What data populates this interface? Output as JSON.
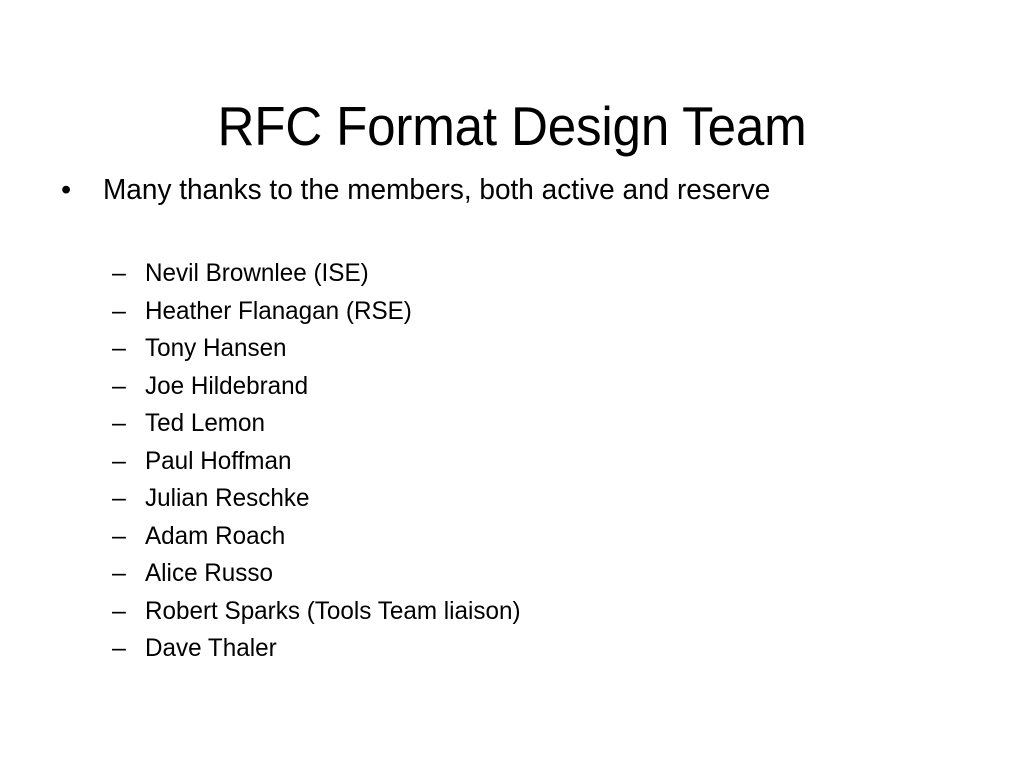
{
  "slide": {
    "background_color": "#FFFFFF",
    "text_color": "#000000",
    "title": "RFC Format Design Team",
    "body": {
      "bullet": {
        "marker": "•",
        "text": "Many thanks to the members, both active and reserve"
      },
      "sub_marker": "–",
      "members": [
        {
          "name": "Nevil Brownlee (ISE)"
        },
        {
          "name": "Heather Flanagan (RSE)"
        },
        {
          "name": "Tony Hansen"
        },
        {
          "name": "Joe Hildebrand"
        },
        {
          "name": "Ted Lemon"
        },
        {
          "name": "Paul Hoffman"
        },
        {
          "name": "Julian Reschke"
        },
        {
          "name": "Adam Roach"
        },
        {
          "name": "Alice Russo"
        },
        {
          "name": "Robert Sparks (Tools Team liaison)"
        },
        {
          "name": "Dave Thaler"
        }
      ]
    }
  }
}
